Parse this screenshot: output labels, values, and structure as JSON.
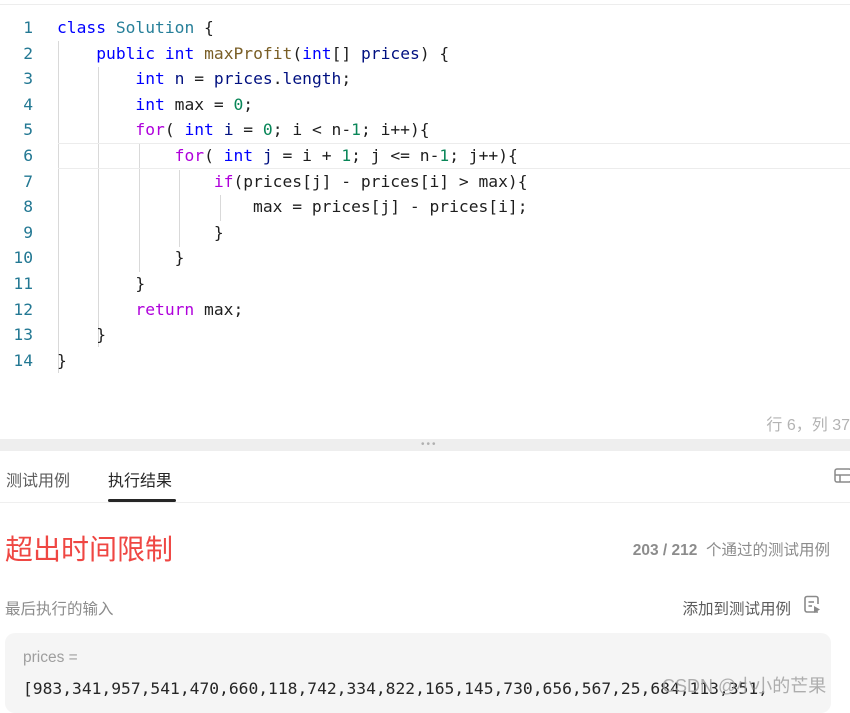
{
  "editor": {
    "lines": [
      {
        "num": "1",
        "tokens": [
          [
            "kw",
            "class"
          ],
          [
            "",
            ""
          ],
          [
            "ty",
            " Solution"
          ],
          [
            "",
            " {"
          ]
        ]
      },
      {
        "num": "2"
      },
      {
        "num": "3"
      },
      {
        "num": "4"
      },
      {
        "num": "5"
      },
      {
        "num": "6"
      },
      {
        "num": "7"
      },
      {
        "num": "8"
      },
      {
        "num": "9"
      },
      {
        "num": "10"
      },
      {
        "num": "11"
      },
      {
        "num": "12"
      },
      {
        "num": "13"
      },
      {
        "num": "14"
      }
    ],
    "code": [
      [
        [
          "kw",
          "class"
        ],
        [
          "",
          " "
        ],
        [
          "ty",
          "Solution"
        ],
        [
          "",
          " {"
        ]
      ],
      [
        [
          "",
          " "
        ],
        [
          "kw",
          "public"
        ],
        [
          "",
          " "
        ],
        [
          "kw",
          "int"
        ],
        [
          "",
          " "
        ],
        [
          "fn",
          "maxProfit"
        ],
        [
          "",
          "("
        ],
        [
          "kw",
          "int"
        ],
        [
          "",
          "[] "
        ],
        [
          "var",
          "prices"
        ],
        [
          "",
          ") {"
        ]
      ],
      [
        [
          "",
          "        "
        ],
        [
          "kw",
          "int"
        ],
        [
          "",
          " "
        ],
        [
          "var",
          "n"
        ],
        [
          "",
          " = "
        ],
        [
          "var",
          "prices"
        ],
        [
          "",
          "."
        ],
        [
          "var",
          "length"
        ],
        [
          "",
          ";"
        ]
      ],
      [
        [
          "",
          "        "
        ],
        [
          "kw",
          "int"
        ],
        [
          "",
          " max = "
        ],
        [
          "num",
          "0"
        ],
        [
          "",
          ";"
        ]
      ],
      [
        [
          "",
          "        "
        ],
        [
          "kw2",
          "for"
        ],
        [
          "",
          "( "
        ],
        [
          "kw",
          "int"
        ],
        [
          "",
          " "
        ],
        [
          "var",
          "i"
        ],
        [
          "",
          " = "
        ],
        [
          "num",
          "0"
        ],
        [
          "",
          "; i < n-"
        ],
        [
          "num",
          "1"
        ],
        [
          "",
          "; i++){"
        ]
      ],
      [
        [
          "",
          "            "
        ],
        [
          "kw2",
          "for"
        ],
        [
          "",
          "( "
        ],
        [
          "kw",
          "int"
        ],
        [
          "",
          " "
        ],
        [
          "var",
          "j"
        ],
        [
          "",
          " = i + "
        ],
        [
          "num",
          "1"
        ],
        [
          "",
          "; j <= n-"
        ],
        [
          "num",
          "1"
        ],
        [
          "",
          "; j++){"
        ]
      ],
      [
        [
          "",
          "                "
        ],
        [
          "kw2",
          "if"
        ],
        [
          "",
          "(prices[j] - prices[i] > max){"
        ]
      ],
      [
        [
          "",
          "                    max = prices[j] - prices[i];"
        ]
      ],
      [
        [
          "",
          "                }"
        ]
      ],
      [
        [
          "",
          "            }"
        ]
      ],
      [
        [
          "",
          "        }"
        ]
      ],
      [
        [
          "",
          "        "
        ],
        [
          "kw2",
          "return"
        ],
        [
          "",
          " max;"
        ]
      ],
      [
        [
          "",
          "    }"
        ]
      ],
      [
        [
          "",
          "}"
        ]
      ]
    ],
    "cursor_position": "行 6，列 37"
  },
  "console": {
    "tabs": [
      {
        "label": "测试用例",
        "active": false
      },
      {
        "label": "执行结果",
        "active": true
      }
    ],
    "result_status": "超出时间限制",
    "passed_count": "203 / 212",
    "passed_label": "个通过的测试用例",
    "last_input_label": "最后执行的输入",
    "add_testcase_label": "添加到测试用例",
    "param_name": "prices =",
    "param_value": "[983,341,957,541,470,660,118,742,334,822,165,145,730,656,567,25,684,113,351,",
    "status_color": "#ef4743"
  },
  "watermark": "CSDN @小小的芒果"
}
